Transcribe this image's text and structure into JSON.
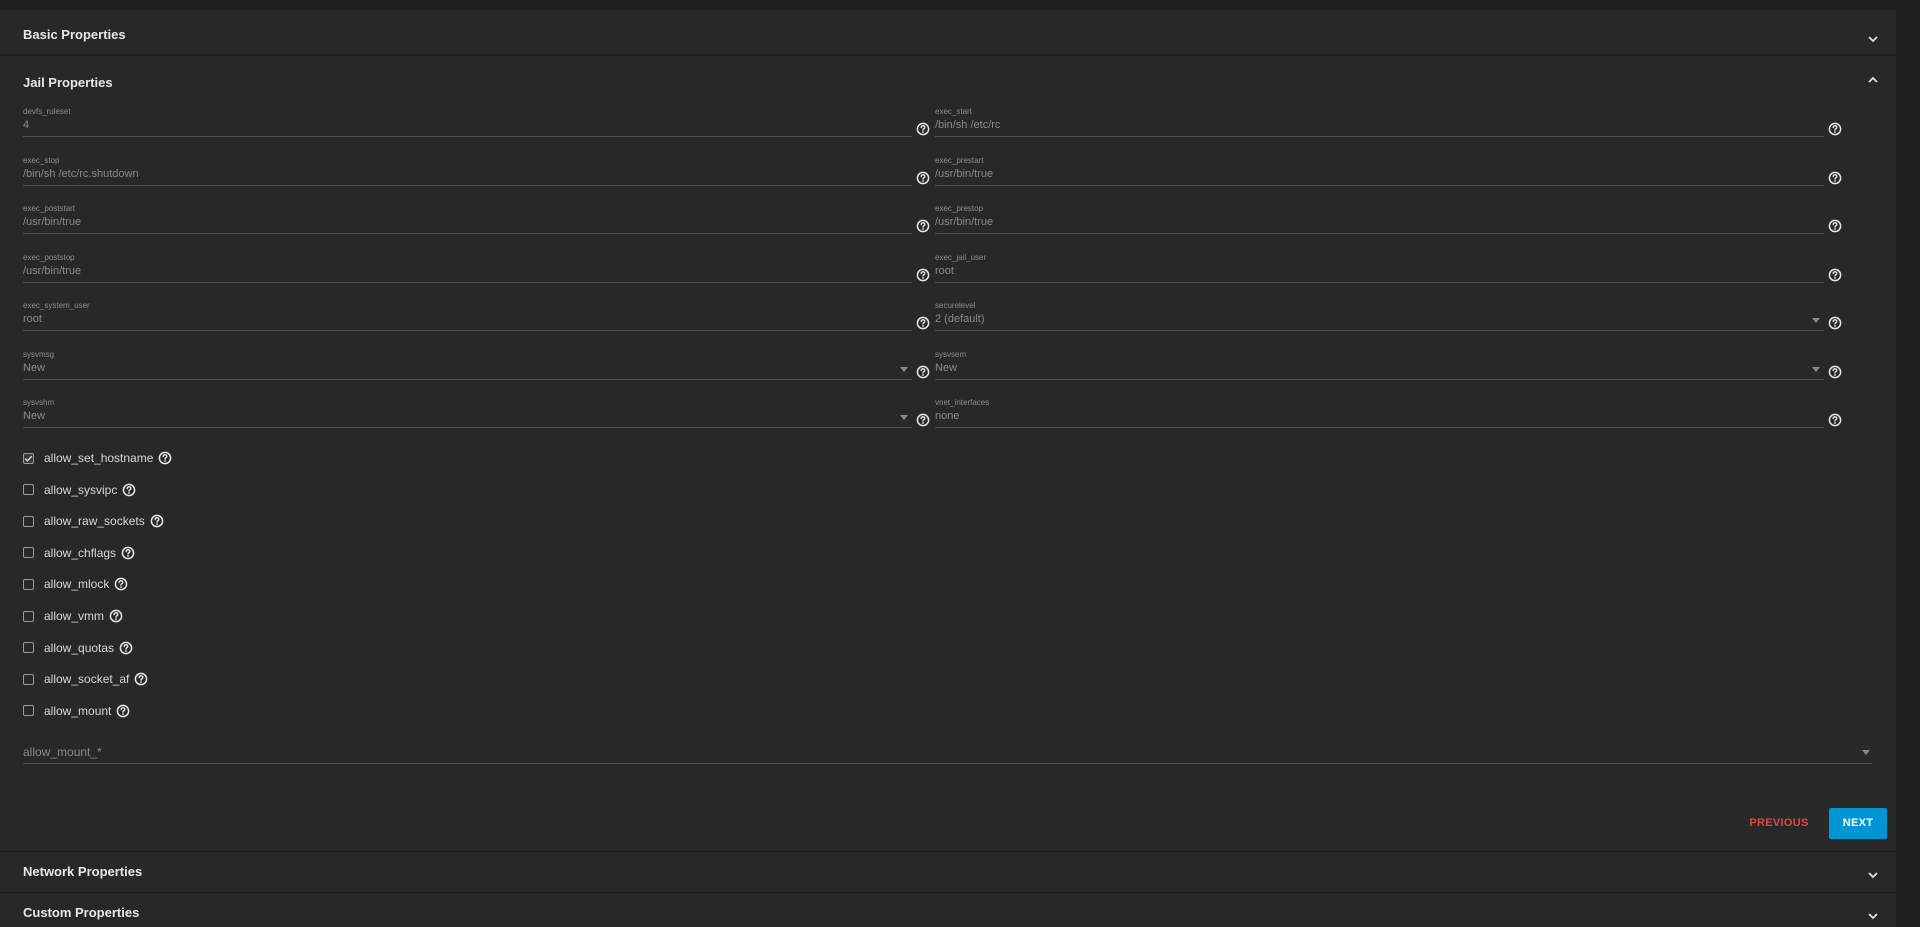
{
  "sections": {
    "basic": {
      "title": "Basic Properties"
    },
    "jail": {
      "title": "Jail Properties"
    },
    "network": {
      "title": "Network Properties"
    },
    "custom": {
      "title": "Custom Properties"
    }
  },
  "fields": [
    {
      "label": "devfs_ruleset",
      "value": "4"
    },
    {
      "label": "exec_start",
      "value": "/bin/sh /etc/rc"
    },
    {
      "label": "exec_stop",
      "value": "/bin/sh /etc/rc.shutdown"
    },
    {
      "label": "exec_prestart",
      "value": "/usr/bin/true"
    },
    {
      "label": "exec_poststart",
      "value": "/usr/bin/true"
    },
    {
      "label": "exec_prestop",
      "value": "/usr/bin/true"
    },
    {
      "label": "exec_poststop",
      "value": "/usr/bin/true"
    },
    {
      "label": "exec_jail_user",
      "value": "root"
    },
    {
      "label": "exec_system_user",
      "value": "root"
    },
    {
      "label": "securelevel",
      "value": "2 (default)"
    },
    {
      "label": "sysvmsg",
      "value": "New"
    },
    {
      "label": "sysvsem",
      "value": "New"
    },
    {
      "label": "sysvshm",
      "value": "New"
    },
    {
      "label": "vnet_interfaces",
      "value": "none"
    }
  ],
  "checkboxes": [
    {
      "label": "allow_set_hostname",
      "checked": true
    },
    {
      "label": "allow_sysvipc",
      "checked": false
    },
    {
      "label": "allow_raw_sockets",
      "checked": false
    },
    {
      "label": "allow_chflags",
      "checked": false
    },
    {
      "label": "allow_mlock",
      "checked": false
    },
    {
      "label": "allow_vmm",
      "checked": false
    },
    {
      "label": "allow_quotas",
      "checked": false
    },
    {
      "label": "allow_socket_af",
      "checked": false
    },
    {
      "label": "allow_mount",
      "checked": false
    }
  ],
  "mount_select": {
    "placeholder": "allow_mount_*"
  },
  "buttons": {
    "previous": "PREVIOUS",
    "next": "NEXT"
  },
  "colors": {
    "accent": "#0095d5",
    "danger": "#e0483c",
    "panel": "#282828",
    "background": "#1e1e1e"
  }
}
